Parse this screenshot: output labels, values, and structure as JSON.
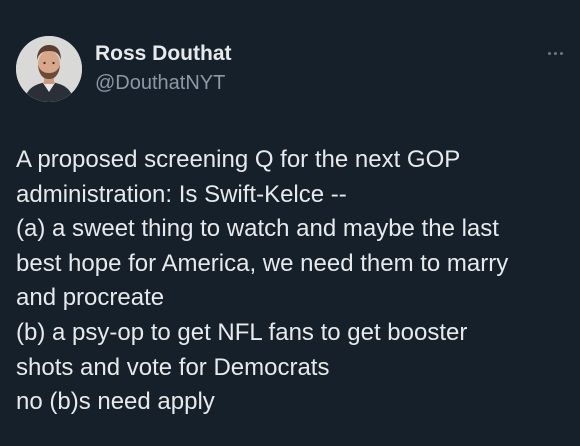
{
  "author": {
    "display_name": "Ross Douthat",
    "handle": "@DouthatNYT",
    "avatar_icon": "profile-photo"
  },
  "more_icon": "more-horizontal-icon",
  "tweet": {
    "lines": [
      "A proposed screening Q for the next GOP",
      "administration: Is Swift-Kelce --",
      "(a) a sweet thing to watch and maybe the last",
      "best hope for America, we need them to marry",
      "and procreate",
      "(b) a psy-op to get NFL fans to get booster",
      "shots and vote for Democrats",
      "no (b)s need apply"
    ]
  },
  "colors": {
    "background": "#15202b",
    "text_primary": "#e7e9ea",
    "text_secondary": "#8b98a5"
  }
}
